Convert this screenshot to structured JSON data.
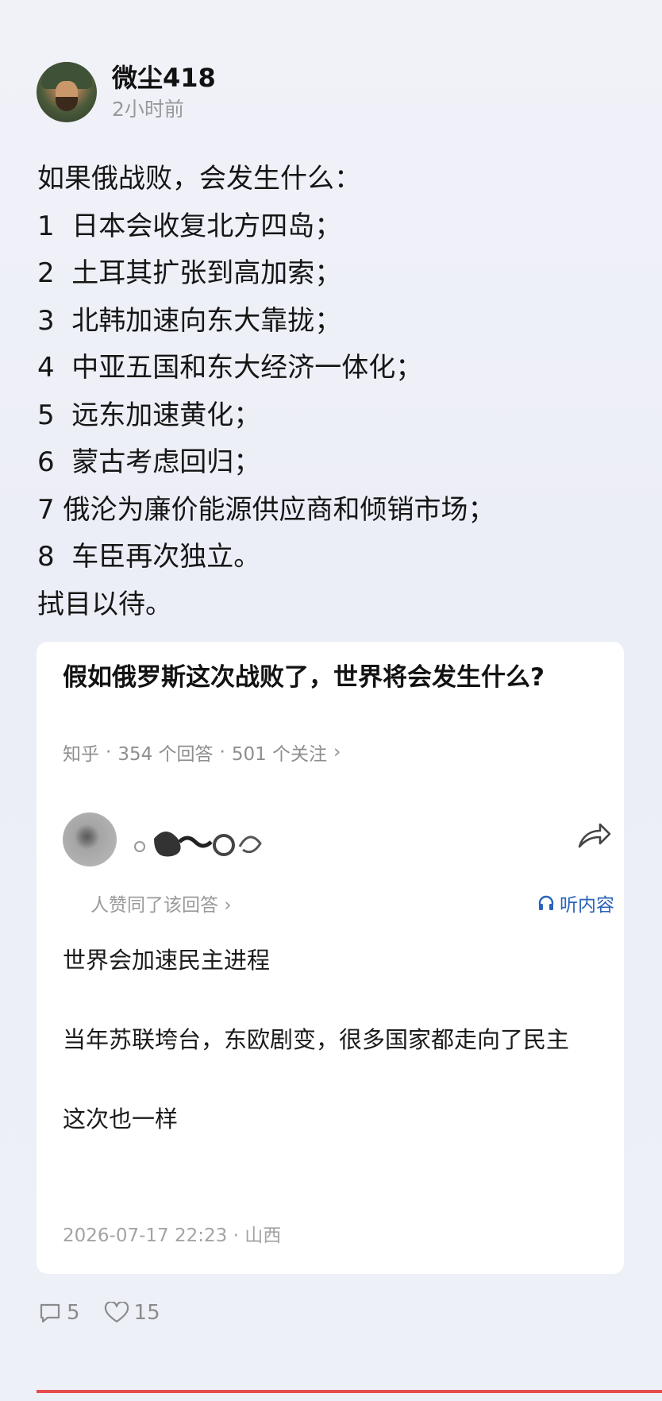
{
  "post": {
    "author": "微尘418",
    "time": "2小时前",
    "lines": [
      "如果俄战败，会发生什么：",
      "1  日本会收复北方四岛；",
      "2  土耳其扩张到高加索；",
      "3  北韩加速向东大靠拢；",
      "4  中亚五国和东大经济一体化；",
      "5  远东加速黄化；",
      "6  蒙古考虑回归；",
      "7 俄沦为廉价能源供应商和倾销市场；",
      "8  车臣再次独立。",
      "拭目以待。"
    ]
  },
  "quote": {
    "title": "假如俄罗斯这次战败了，世界将会发生什么?",
    "source": "知乎",
    "answers": "354 个回答",
    "followers": "501 个关注",
    "answer_agree": "人赞同了该回答",
    "listen": "听内容",
    "content": [
      "世界会加速民主进程",
      "当年苏联垮台，东欧剧变，很多国家都走向了民主",
      "这次也一样"
    ],
    "date": "2026-07-17 22:23",
    "location": "山西"
  },
  "footer": {
    "comments": "5",
    "likes": "15"
  },
  "icons": [
    "avatar",
    "share-icon",
    "headphones-icon",
    "comment-icon",
    "heart-icon"
  ]
}
